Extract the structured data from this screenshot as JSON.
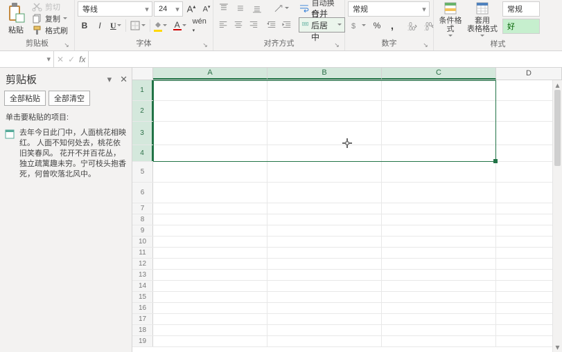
{
  "ribbon": {
    "clipboard": {
      "paste_label": "粘贴",
      "cut_label": "剪切",
      "copy_label": "复制",
      "format_painter_label": "格式刷",
      "group_label": "剪贴板"
    },
    "font": {
      "font_name": "等线",
      "font_size": "24",
      "bold": "B",
      "italic": "I",
      "underline": "U",
      "group_label": "字体"
    },
    "alignment": {
      "wrap_text_label": "自动换行",
      "merge_center_label": "合并后居中",
      "group_label": "对齐方式"
    },
    "number": {
      "format_selected": "常规",
      "group_label": "数字"
    },
    "styles": {
      "cond_format_label": "条件格式",
      "table_format_label": "套用\n表格格式",
      "style_normal": "常规",
      "style_good": "好",
      "group_label": "样式"
    }
  },
  "formula_bar": {
    "name_box": "",
    "cancel": "✕",
    "enter": "✓",
    "fx": "fx",
    "formula_value": ""
  },
  "taskpane": {
    "title": "剪贴板",
    "paste_all_label": "全部粘贴",
    "clear_all_label": "全部清空",
    "hint": "单击要粘贴的项目:",
    "items": [
      {
        "text": "去年今日此门中，人面桃花相映红。 人面不知何处去，桃花依旧笑春风。 花开不并百花丛，独立疏篱趣未穷。宁可枝头抱香死，何曾吹落北风中。"
      }
    ]
  },
  "grid": {
    "columns": [
      "A",
      "B",
      "C",
      "D"
    ],
    "rows": [
      1,
      2,
      3,
      4,
      5,
      6,
      7,
      8,
      9,
      10,
      11,
      12,
      13,
      14,
      15,
      16,
      17,
      18,
      19
    ],
    "selected_cols": [
      "A",
      "B",
      "C"
    ],
    "selected_rows": [
      1,
      2,
      3,
      4
    ]
  }
}
